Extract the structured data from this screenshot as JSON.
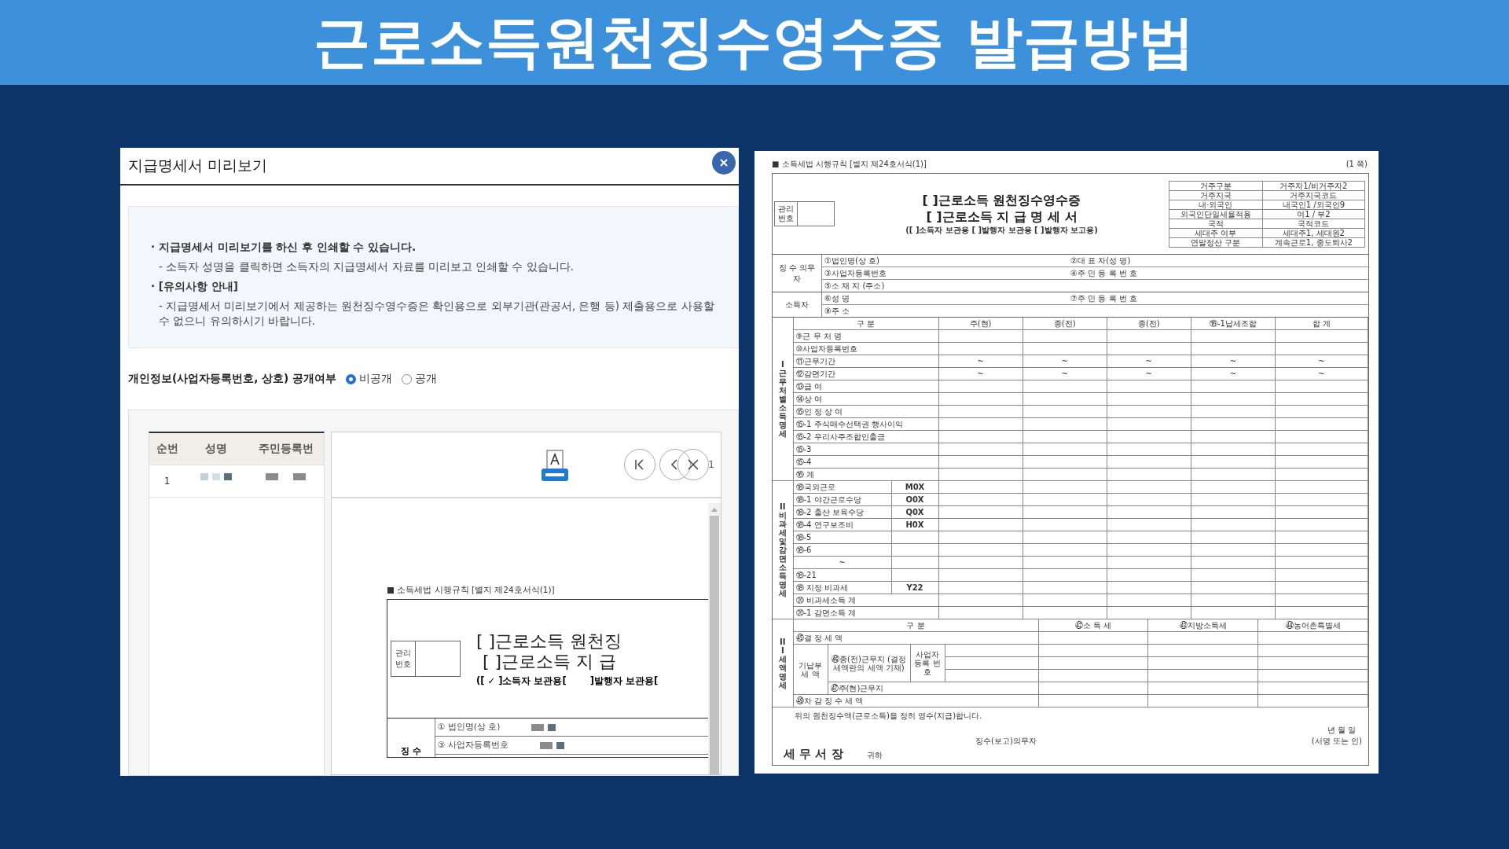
{
  "header": {
    "title": "근로소득원천징수영수증 발급방법"
  },
  "preview_dialog": {
    "title": "지급명세서 미리보기",
    "notices": [
      {
        "kind": "bullet",
        "text": "· 지급명세서 미리보기를 하신 후 인쇄할 수 있습니다."
      },
      {
        "kind": "detail",
        "text": "- 소득자 성명을 클릭하면 소득자의 지급명세서 자료를 미리보고 인쇄할 수 있습니다."
      },
      {
        "kind": "bullet",
        "text": "· [유의사항 안내]"
      },
      {
        "kind": "detail",
        "text": "- 지급명세서 미리보기에서 제공하는 원천징수영수증은 확인용으로 외부기관(관공서, 은행 등) 제출용으로 사용할 수 없으니 유의하시기 바랍니다."
      }
    ],
    "privacy": {
      "label": "개인정보(사업자등록번호, 상호) 공개여부",
      "options": [
        {
          "label": "비공개",
          "selected": true
        },
        {
          "label": "공개",
          "selected": false
        }
      ]
    },
    "earner_table": {
      "columns": [
        "순번",
        "성명",
        "주민등록번"
      ],
      "rows": [
        {
          "number": "1"
        }
      ]
    },
    "viewer": {
      "page_number": "1",
      "document": {
        "form_label": "■ 소득세법 시행규칙 [별지 제24호서식(1)]",
        "management_label": "관리 번호",
        "titles": [
          "[ ]근로소득 원천징",
          "[ ]근로소득 지 급"
        ],
        "copy_marks": [
          "([ ✓ ]소득자 보관용[",
          "]발행자 보관용["
        ],
        "rows": [
          "① 법인명(상 호)",
          "③ 사업자등록번호"
        ],
        "party_label": "징 수"
      }
    }
  },
  "withholding_form": {
    "form_label": "■ 소득세법 시행규칙 [별지 제24호서식(1)]",
    "page_label": "(1 쪽)",
    "management_label": "관리 번호",
    "titles": [
      "[ ]근로소득 원천징수영수증",
      "[ ]근로소득 지 급 명 세 서"
    ],
    "copy_line": "([ ]소득자 보관용 [ ]발행자 보관용 [ ]발행자 보고용)",
    "residency": [
      {
        "label": "거주구분",
        "value": "거주자1/비거주자2"
      },
      {
        "label": "거주지국",
        "value": "거주지국코드"
      },
      {
        "label": "내·외국인",
        "value": "내국인1 /외국인9"
      },
      {
        "label": "외국인단일세율적용",
        "value": "여1 / 부2"
      },
      {
        "label": "국적",
        "value": "국적코드"
      },
      {
        "label": "세대주 여부",
        "value": "세대주1, 세대원2"
      },
      {
        "label": "연말정산 구분",
        "value": "계속근로1, 중도퇴사2"
      }
    ],
    "parties": [
      {
        "label": "징 수 의무자",
        "rows": [
          [
            "①법인명(상 호)",
            "②대 표 자(성 명)"
          ],
          [
            "③사업자등록번호",
            "④주 민 등 록 번 호"
          ],
          [
            "⑤소 재 지 (주소)"
          ]
        ]
      },
      {
        "label": "소득자",
        "rows": [
          [
            "⑥성 명",
            "⑦주 민 등 록 번 호"
          ],
          [
            "⑧주 소"
          ]
        ]
      }
    ],
    "workplace_income": {
      "label": "I 근무처별소득명세",
      "columns": [
        "구 분",
        "주(현)",
        "종(전)",
        "종(전)",
        "⑯-1납세조합",
        "합 계"
      ],
      "rows": [
        {
          "item": "⑨근 무 처 명"
        },
        {
          "item": "⑩사업자등록번호"
        },
        {
          "item": "⑪근무기간",
          "values": [
            "~",
            "~",
            "~",
            "~",
            "~"
          ]
        },
        {
          "item": "⑫감면기간",
          "values": [
            "~",
            "~",
            "~",
            "~",
            "~"
          ]
        },
        {
          "item": "⑬급 여"
        },
        {
          "item": "⑭상 여"
        },
        {
          "item": "⑮인 정 상 여"
        },
        {
          "item": "⑮-1 주식매수선택권 행사이익"
        },
        {
          "item": "⑮-2 우리사주조합인출금"
        },
        {
          "item": "⑮-3"
        },
        {
          "item": "⑮-4"
        },
        {
          "item": "⑯ 계"
        }
      ]
    },
    "nontaxable_income": {
      "label": "II 비과세및감면소득명세",
      "rows": [
        {
          "item": "⑱국외근로",
          "code": "M0X"
        },
        {
          "item": "⑱-1 야간근로수당",
          "code": "O0X"
        },
        {
          "item": "⑱-2 출산 보육수당",
          "code": "Q0X"
        },
        {
          "item": "⑱-4 연구보조비",
          "code": "H0X"
        },
        {
          "item": "⑱-5"
        },
        {
          "item": "⑱-6"
        },
        {
          "item": "~"
        },
        {
          "item": "⑱-21"
        },
        {
          "item": "⑱ 지정 비과세",
          "code": "Y22"
        },
        {
          "item": "⑳ 비과세소득 계",
          "kind": "total"
        },
        {
          "item": "⑳-1 감면소득 계",
          "kind": "total"
        }
      ]
    },
    "tax_details": {
      "label": "III 세액명세",
      "columns": [
        "구 분",
        "㊷소 득 세",
        "㊸지방소득세",
        "㊹농어촌특별세"
      ],
      "determined": "㊺결 정 세 액",
      "prepaid_label": "기납부 세 액",
      "previous_workplace": "㊻종(전)근무지 (결정세액란의 세액 기재)",
      "registration_label": "사업자 등록 번호",
      "current_workplace": "㊼주(현)근무지",
      "balance": "㊾차 감 징 수 세 액"
    },
    "footer": {
      "statement": "위의 원천징수액(근로소득)을 정히 영수(지급)합니다.",
      "date": "년 월 일",
      "payer": "징수(보고)의무자",
      "signature": "(서명 또는 인)",
      "office": "세 무 서 장",
      "honorific": "귀하"
    }
  }
}
